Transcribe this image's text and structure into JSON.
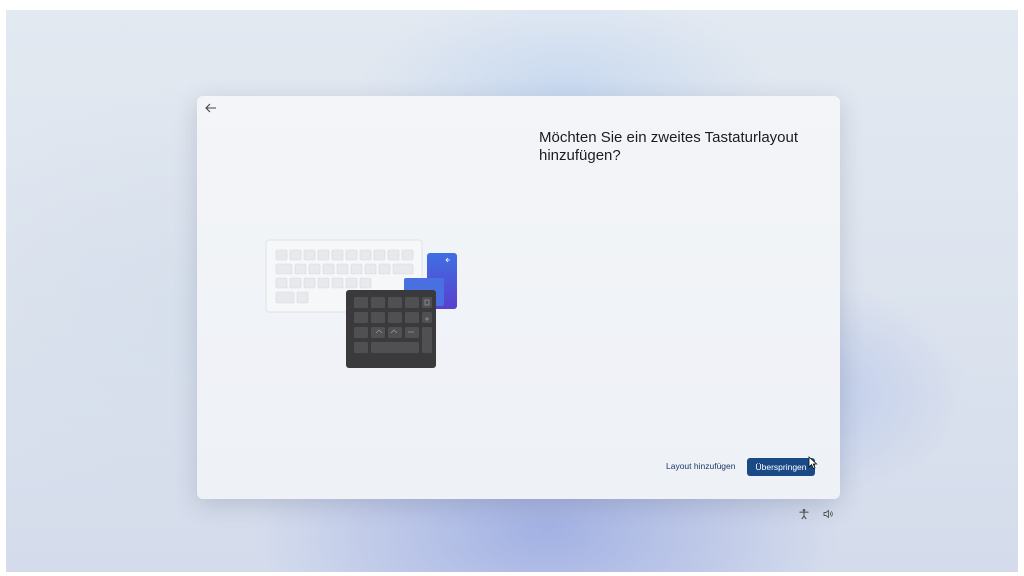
{
  "dialog": {
    "title": "Möchten Sie ein zweites Tastaturlayout hinzufügen?",
    "back_icon": "arrow-left-icon",
    "illustration": "keyboard-illustration"
  },
  "actions": {
    "secondary_label": "Layout hinzufügen",
    "primary_label": "Überspringen"
  },
  "tray": {
    "icons": [
      "accessibility-icon",
      "volume-icon"
    ]
  },
  "colors": {
    "primary_button": "#1a4a86",
    "link_text": "#1b3a66",
    "dialog_background": "#f1f3f7",
    "keypad_dark": "#3a3a3c",
    "blue_card": "#3a63d8"
  }
}
